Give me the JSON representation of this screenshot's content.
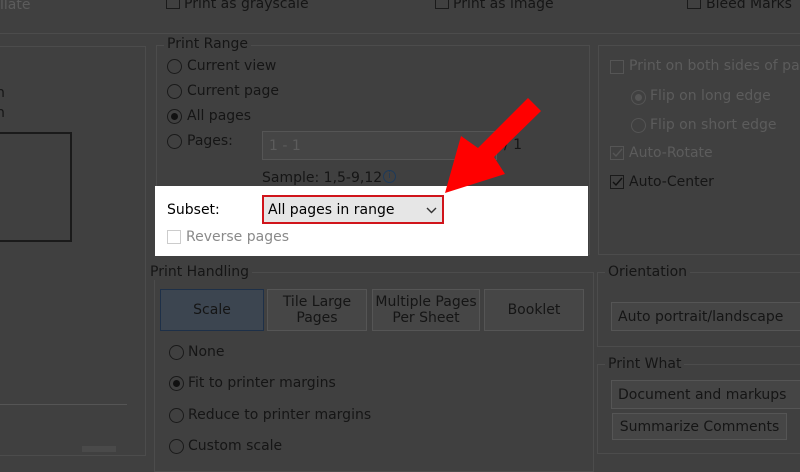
{
  "top": {
    "collate": "llate",
    "grayscale": "Print as grayscale",
    "image": "Print as image",
    "bleed": "Bleed Marks"
  },
  "left": {
    "line1": "n",
    "line2": "n"
  },
  "print_range": {
    "title": "Print Range",
    "current_view": "Current view",
    "current_page": "Current page",
    "all_pages": "All pages",
    "pages": "Pages:",
    "pages_value": "1 - 1",
    "pages_total": "/ 1",
    "sample": "Sample: 1,5-9,12",
    "subset_label": "Subset:",
    "subset_value": "All pages in range",
    "reverse": "Reverse pages"
  },
  "duplex": {
    "both_sides": "Print on both sides of pap",
    "long_edge": "Flip on long edge",
    "short_edge": "Flip on short edge",
    "auto_rotate": "Auto-Rotate",
    "auto_center": "Auto-Center"
  },
  "handling": {
    "title": "Print Handling",
    "tabs": [
      "Scale",
      "Tile Large Pages",
      "Multiple Pages Per Sheet",
      "Booklet"
    ],
    "none": "None",
    "fit": "Fit to printer margins",
    "reduce": "Reduce to printer margins",
    "custom": "Custom scale"
  },
  "orientation": {
    "title": "Orientation",
    "value": "Auto portrait/landscape"
  },
  "print_what": {
    "title": "Print What",
    "value": "Document and markups",
    "summarize": "Summarize Comments"
  },
  "colors": {
    "highlight": "#ffffff",
    "accent": "#d0141b",
    "arrow": "#ff0000"
  }
}
